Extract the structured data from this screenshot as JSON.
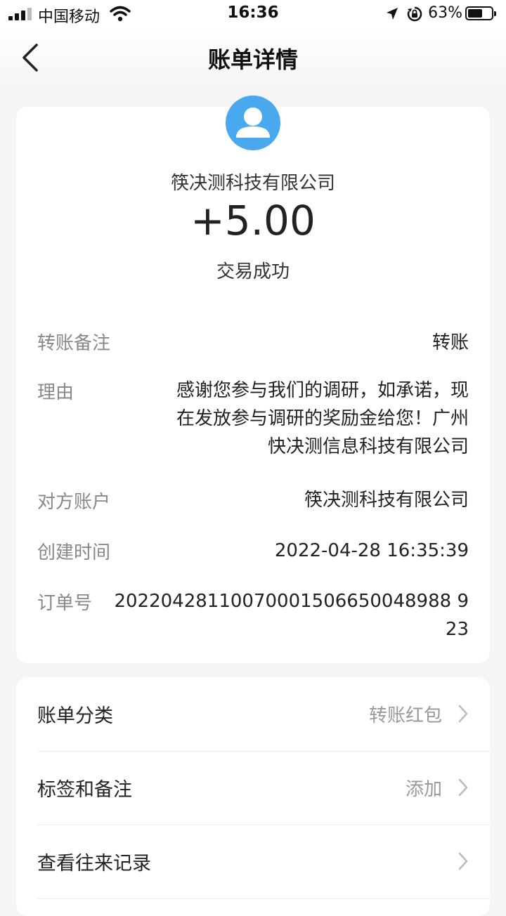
{
  "status_bar": {
    "carrier": "中国移动",
    "time": "16:36",
    "battery": "63%",
    "battery_level": 0.63,
    "icons": [
      "signal-icon",
      "wifi-icon",
      "location-icon",
      "rotation-lock-icon",
      "battery-icon"
    ]
  },
  "nav": {
    "back_icon": "chevron-left-icon",
    "title": "账单详情"
  },
  "summary": {
    "avatar_icon": "user-avatar-icon",
    "avatar_color": "#4aa8ee",
    "payer": "筷决测科技有限公司",
    "amount": "+5.00",
    "status": "交易成功"
  },
  "details": {
    "memo": {
      "label": "转账备注",
      "value": "转账"
    },
    "reason": {
      "label": "理由",
      "lines": [
        "感谢您参与我们的调研，如承诺，现",
        "在发放参与调研的奖励金给您！广州",
        "快决测信息科技有限公司"
      ]
    },
    "counterparty": {
      "label": "对方账户",
      "value": "筷决测科技有限公司"
    },
    "created": {
      "label": "创建时间",
      "value": "2022-04-28 16:35:39"
    },
    "order": {
      "label": "订单号",
      "lines": [
        "20220428110070001506650048988 9",
        "23"
      ]
    }
  },
  "menu": {
    "category": {
      "label": "账单分类",
      "value": "转账红包"
    },
    "tags": {
      "label": "标签和备注",
      "value": "添加"
    },
    "history": {
      "label": "查看往来记录"
    }
  }
}
